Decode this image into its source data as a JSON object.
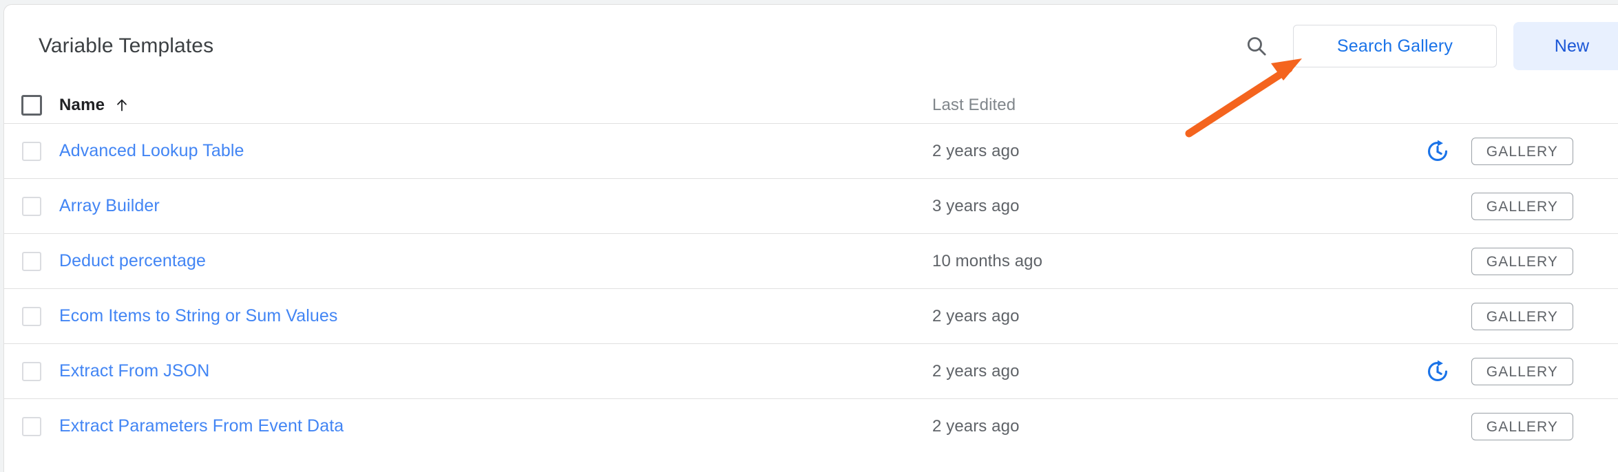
{
  "panel": {
    "title": "Variable Templates"
  },
  "toolbar": {
    "search_icon": "search-icon",
    "search_gallery_label": "Search Gallery",
    "new_label": "New"
  },
  "table": {
    "columns": {
      "name": "Name",
      "last_edited": "Last Edited",
      "sort_indicator": "arrow-up-icon"
    },
    "rows": [
      {
        "name": "Advanced Lookup Table",
        "last_edited": "2 years ago",
        "has_update": true,
        "badge": "GALLERY"
      },
      {
        "name": "Array Builder",
        "last_edited": "3 years ago",
        "has_update": false,
        "badge": "GALLERY"
      },
      {
        "name": "Deduct percentage",
        "last_edited": "10 months ago",
        "has_update": false,
        "badge": "GALLERY"
      },
      {
        "name": "Ecom Items to String or Sum Values",
        "last_edited": "2 years ago",
        "has_update": false,
        "badge": "GALLERY"
      },
      {
        "name": "Extract From JSON",
        "last_edited": "2 years ago",
        "has_update": true,
        "badge": "GALLERY"
      },
      {
        "name": "Extract Parameters From Event Data",
        "last_edited": "2 years ago",
        "has_update": false,
        "badge": "GALLERY"
      }
    ]
  },
  "annotation": {
    "type": "arrow",
    "color": "#f4641e",
    "points_to": "Search Gallery"
  },
  "colors": {
    "link_blue": "#4285f4",
    "button_blue": "#1a73e8",
    "new_bg": "#e8f0fe",
    "new_text": "#1a56d6",
    "update_icon_blue": "#1a73e8",
    "divider": "#e0e0e0",
    "text_primary": "#202124",
    "text_secondary": "#5f6368"
  }
}
